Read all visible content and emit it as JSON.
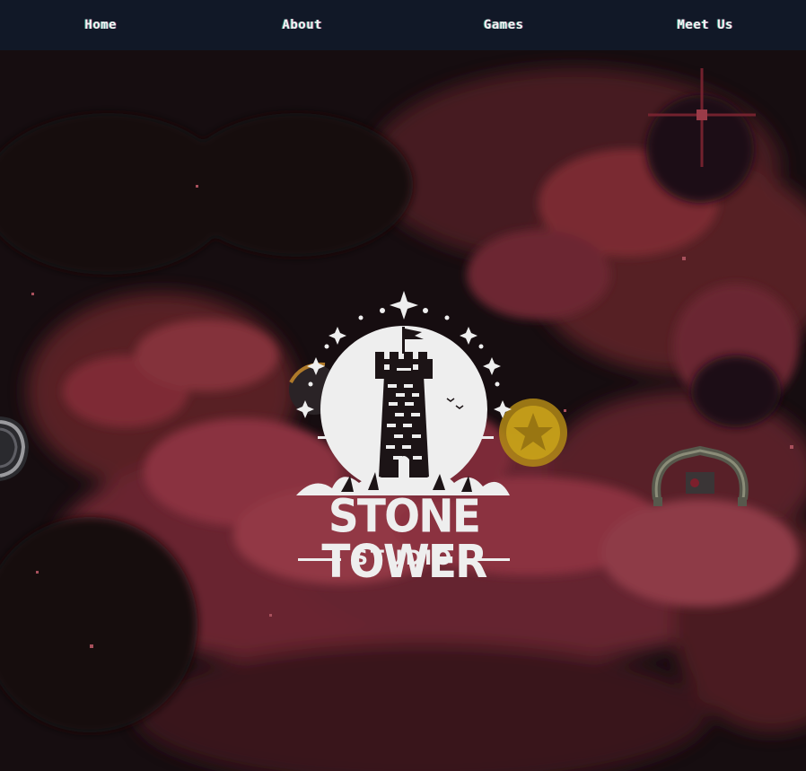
{
  "nav": {
    "items": [
      {
        "label": "Home"
      },
      {
        "label": "About"
      },
      {
        "label": "Games"
      },
      {
        "label": "Meet Us"
      }
    ]
  },
  "logo": {
    "title": "STONE TOWER",
    "subtitle": "STUDIO"
  },
  "colors": {
    "navbar": "#111827",
    "nav_text": "#f2f2f2",
    "sky_dark": "#160d10",
    "cloud_red": "#8a2f3a",
    "logo_white": "#eeeeee",
    "coin": "#c9a21a"
  },
  "icons": [
    "tower-icon",
    "flag-icon",
    "sparkle-icon",
    "bird-icon",
    "coin-icon",
    "claw-creature-icon",
    "bomb-icon",
    "cannon-icon"
  ]
}
